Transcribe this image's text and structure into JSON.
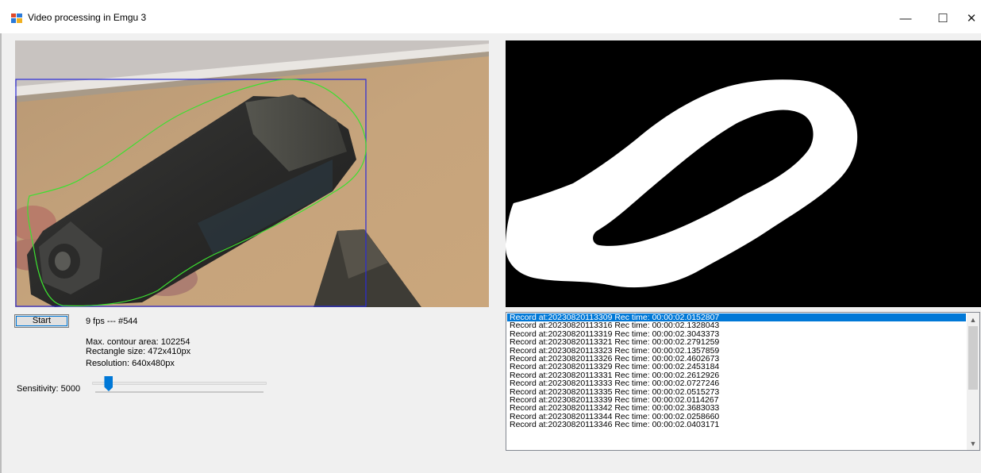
{
  "window": {
    "title": "Video processing in Emgu 3",
    "minimize_glyph": "—",
    "maximize_glyph": "☐",
    "close_glyph": "✕"
  },
  "controls": {
    "start_label": "Start",
    "fps_text": "9 fps --- #544",
    "contour_area": "Max. contour area: 102254",
    "rectangle_size": "Rectangle size: 472x410px",
    "resolution": "Resolution: 640x480px",
    "sensitivity_label": "Sensitivity: 5000",
    "sensitivity_level": 0.08
  },
  "records": [
    "Record at:20230820113309 Rec time: 00:00:02.0152807",
    "Record at:20230820113316 Rec time: 00:00:02.1328043",
    "Record at:20230820113319 Rec time: 00:00:02.3043373",
    "Record at:20230820113321 Rec time: 00:00:02.2791259",
    "Record at:20230820113323 Rec time: 00:00:02.1357859",
    "Record at:20230820113326 Rec time: 00:00:02.4602673",
    "Record at:20230820113329 Rec time: 00:00:02.2453184",
    "Record at:20230820113331 Rec time: 00:00:02.2612926",
    "Record at:20230820113333 Rec time: 00:00:02.0727246",
    "Record at:20230820113335 Rec time: 00:00:02.0515273",
    "Record at:20230820113339 Rec time: 00:00:02.0114267",
    "Record at:20230820113342 Rec time: 00:00:02.3683033",
    "Record at:20230820113344 Rec time: 00:00:02.0258660",
    "Record at:20230820113346 Rec time: 00:00:02.0403171"
  ],
  "selected_index": 0,
  "icons": {
    "app": "app-window-icon",
    "scroll_up": "scroll-up-arrow-icon",
    "scroll_down": "scroll-down-arrow-icon"
  },
  "colors": {
    "selection": "#0078d7",
    "bounding_box": "#2b2bd9",
    "contour": "#3ce030"
  }
}
